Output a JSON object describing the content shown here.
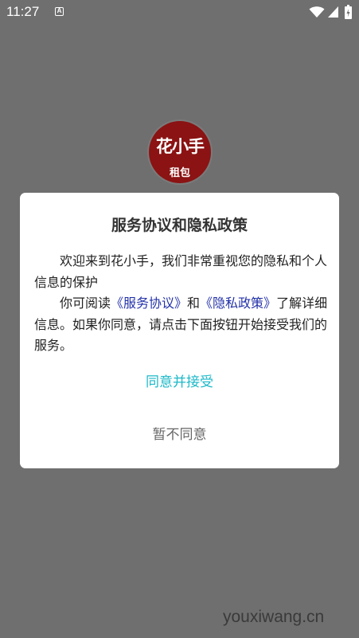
{
  "status_bar": {
    "time": "11:27",
    "notification_glyph": "A",
    "icons": [
      "a-notification-icon",
      "wifi-icon",
      "signal-icon",
      "battery-icon"
    ]
  },
  "app_logo": {
    "main_text": "花小手",
    "sub_text": "租包"
  },
  "dialog": {
    "title": "服务协议和隐私政策",
    "para1": "欢迎来到花小手，我们非常重视您的隐私和个人信息的保护",
    "para2_before": "你可阅读",
    "service_link": "《服务协议》",
    "para2_and": "和",
    "privacy_link": "《隐私政策》",
    "para2_after": "了解详细信息。如果你同意，请点击下面按钮开始接受我们的服务。",
    "agree_label": "同意并接受",
    "disagree_label": "暂不同意"
  },
  "watermark": "youxiwang.cn",
  "colors": {
    "overlay": "#6f6f6f",
    "logo": "#8b1313",
    "link": "#2332a8",
    "accent": "#1cb8c8",
    "secondary_text": "#666666"
  }
}
